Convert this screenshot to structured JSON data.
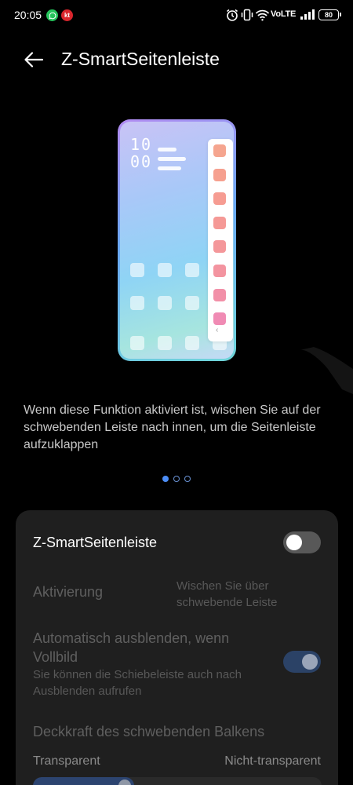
{
  "status_bar": {
    "time": "20:05",
    "notifications": [
      {
        "name": "whatsapp-icon",
        "text": "",
        "color": "#25c45b"
      },
      {
        "name": "kt-icon",
        "text": "kt",
        "color": "#d9262d"
      }
    ],
    "network": "VoLTE",
    "battery": "80"
  },
  "header": {
    "title": "Z-SmartSeitenleiste"
  },
  "illustration": {
    "clock_hour": "10",
    "clock_minute": "00",
    "sidebar_colors": [
      "#f5a58f",
      "#f6a08f",
      "#f69c92",
      "#f59996",
      "#f4979a",
      "#f394a0",
      "#f290a8",
      "#f08bb4"
    ]
  },
  "description": "Wenn diese Funktion aktiviert ist, wischen Sie auf der schwebenden Leiste nach innen, um die Seitenleiste aufzuklappen",
  "pager": {
    "count": 3,
    "active_index": 0,
    "accent": "#4c8df6"
  },
  "settings": {
    "main_toggle": {
      "label": "Z-SmartSeitenleiste",
      "enabled": false
    },
    "activation": {
      "label": "Aktivierung",
      "value": "Wischen Sie über schwebende Leiste"
    },
    "auto_hide": {
      "label": "Automatisch ausblenden, wenn Vollbild",
      "sublabel": "Sie können die Schiebeleiste auch nach Ausblenden aufrufen",
      "enabled": true
    },
    "opacity": {
      "label": "Deckkraft des schwebenden Balkens",
      "min_label": "Transparent",
      "max_label": "Nicht-transparent",
      "value": 0.35
    }
  }
}
